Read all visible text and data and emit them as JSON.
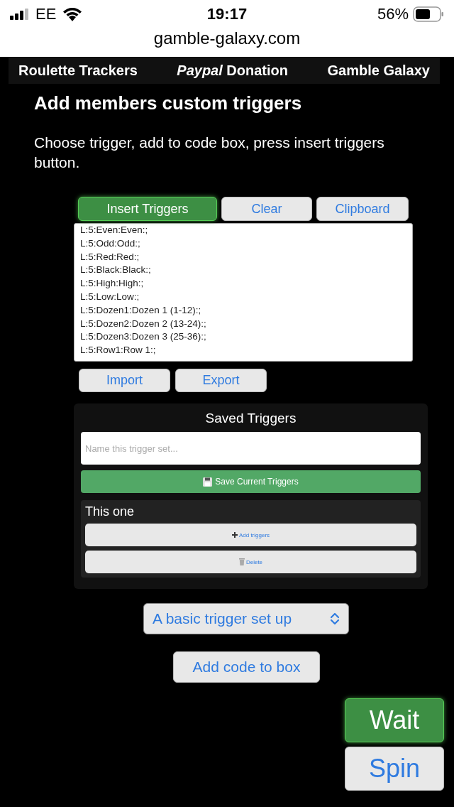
{
  "status_bar": {
    "carrier": "EE",
    "time": "19:17",
    "battery": "56%"
  },
  "address_bar": {
    "url": "gamble-galaxy.com"
  },
  "nav": {
    "links": [
      "Roulette Trackers",
      "*Paypal* Donation",
      "Gamble Galaxy"
    ]
  },
  "heading": "Add members custom triggers",
  "instructions": "Choose trigger, add to code box, press insert triggers button.",
  "top_buttons": [
    {
      "label": "Insert Triggers",
      "highlighted": true
    },
    {
      "label": "Clear",
      "highlighted": false
    },
    {
      "label": "Clipboard",
      "highlighted": false
    }
  ],
  "code_box": {
    "lines": [
      "L:5:Even:Even:;",
      "L:5:Odd:Odd:;",
      "L:5:Red:Red:;",
      "L:5:Black:Black:;",
      "L:5:High:High:;",
      "L:5:Low:Low:;",
      "L:5:Dozen1:Dozen 1 (1-12):;",
      "L:5:Dozen2:Dozen 2 (13-24):;",
      "L:5:Dozen3:Dozen 3 (25-36):;",
      "L:5:Row1:Row 1:;"
    ]
  },
  "io_buttons": [
    "Import",
    "Export"
  ],
  "saved_triggers": {
    "title": "Saved Triggers",
    "name_field": {
      "placeholder": "Name this trigger set..."
    },
    "save_button": "Save Current Triggers",
    "sets": [
      {
        "name": "This one",
        "add_button": "Add triggers",
        "delete_button": "Delete"
      }
    ]
  },
  "trigger_select": {
    "value": "A basic trigger set up"
  },
  "add_code_button": "Add code to box",
  "action_buttons": [
    {
      "label": "Wait",
      "highlighted": true
    },
    {
      "label": "Spin",
      "highlighted": false
    }
  ]
}
